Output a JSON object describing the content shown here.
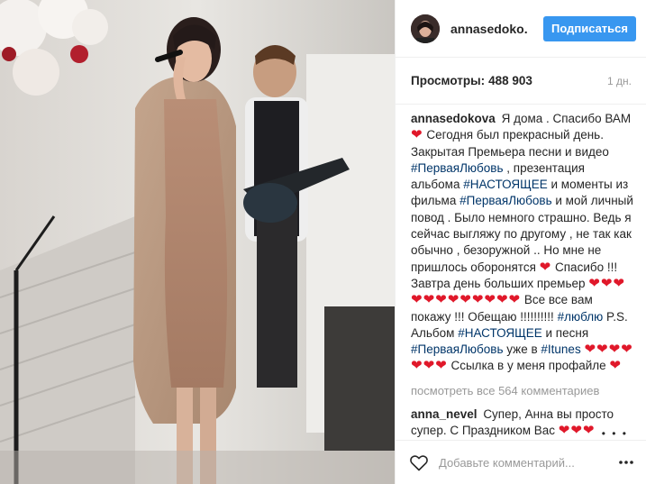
{
  "post": {
    "username": "annasedoko...",
    "follow_label": "Подписаться",
    "views_label": "Просмотры:",
    "views_count": "488 903",
    "time_ago": "1 дн.",
    "caption_user": "annasedokova",
    "caption_parts": {
      "p1": "Я дома . Спасибо ВАМ",
      "p2": "Сегодня был прекрасный день. Закрытая Премьера песни и видео",
      "tag1": "#ПерваяЛюбовь",
      "p3": ", презентация альбома",
      "tag2": "#НАСТОЯЩЕЕ",
      "p4": "и моменты из фильма",
      "tag3": "#ПерваяЛюбовь",
      "p5": "и мой личный повод . Было немного страшно. Ведь я сейчас выгляжу по другому , не так как обычно , безоружной .. Но мне не пришлось оборонятся",
      "p6": "Спасибо !!! Завтра день больших премьер",
      "p7": "Все все вам покажу !!! Обещаю !!!!!!!!!!",
      "tag4": "#люблю",
      "p8": "P.S. Альбом",
      "tag5": "#НАСТОЯЩЕЕ",
      "p9": "и песня",
      "tag6": "#ПерваяЛюбовь",
      "p10": "уже в",
      "tag7": "#Itunes",
      "p11": "Ссылка в у меня профайле"
    },
    "load_more": "посмотреть все 564 комментариев",
    "comment1_user": "anna_nevel",
    "comment1_text": "Супер, Анна вы просто супер. С Праздником Вас",
    "comment_placeholder": "Добавьте комментарий...",
    "more_dots": "• • •"
  },
  "icons": {
    "like": "heart-outline-icon",
    "more": "more-options-icon",
    "heart_emoji": "red-heart-emoji"
  },
  "colors": {
    "accent": "#3897f0",
    "hashtag": "#003569",
    "heart": "#e0182a",
    "muted": "#999999"
  }
}
